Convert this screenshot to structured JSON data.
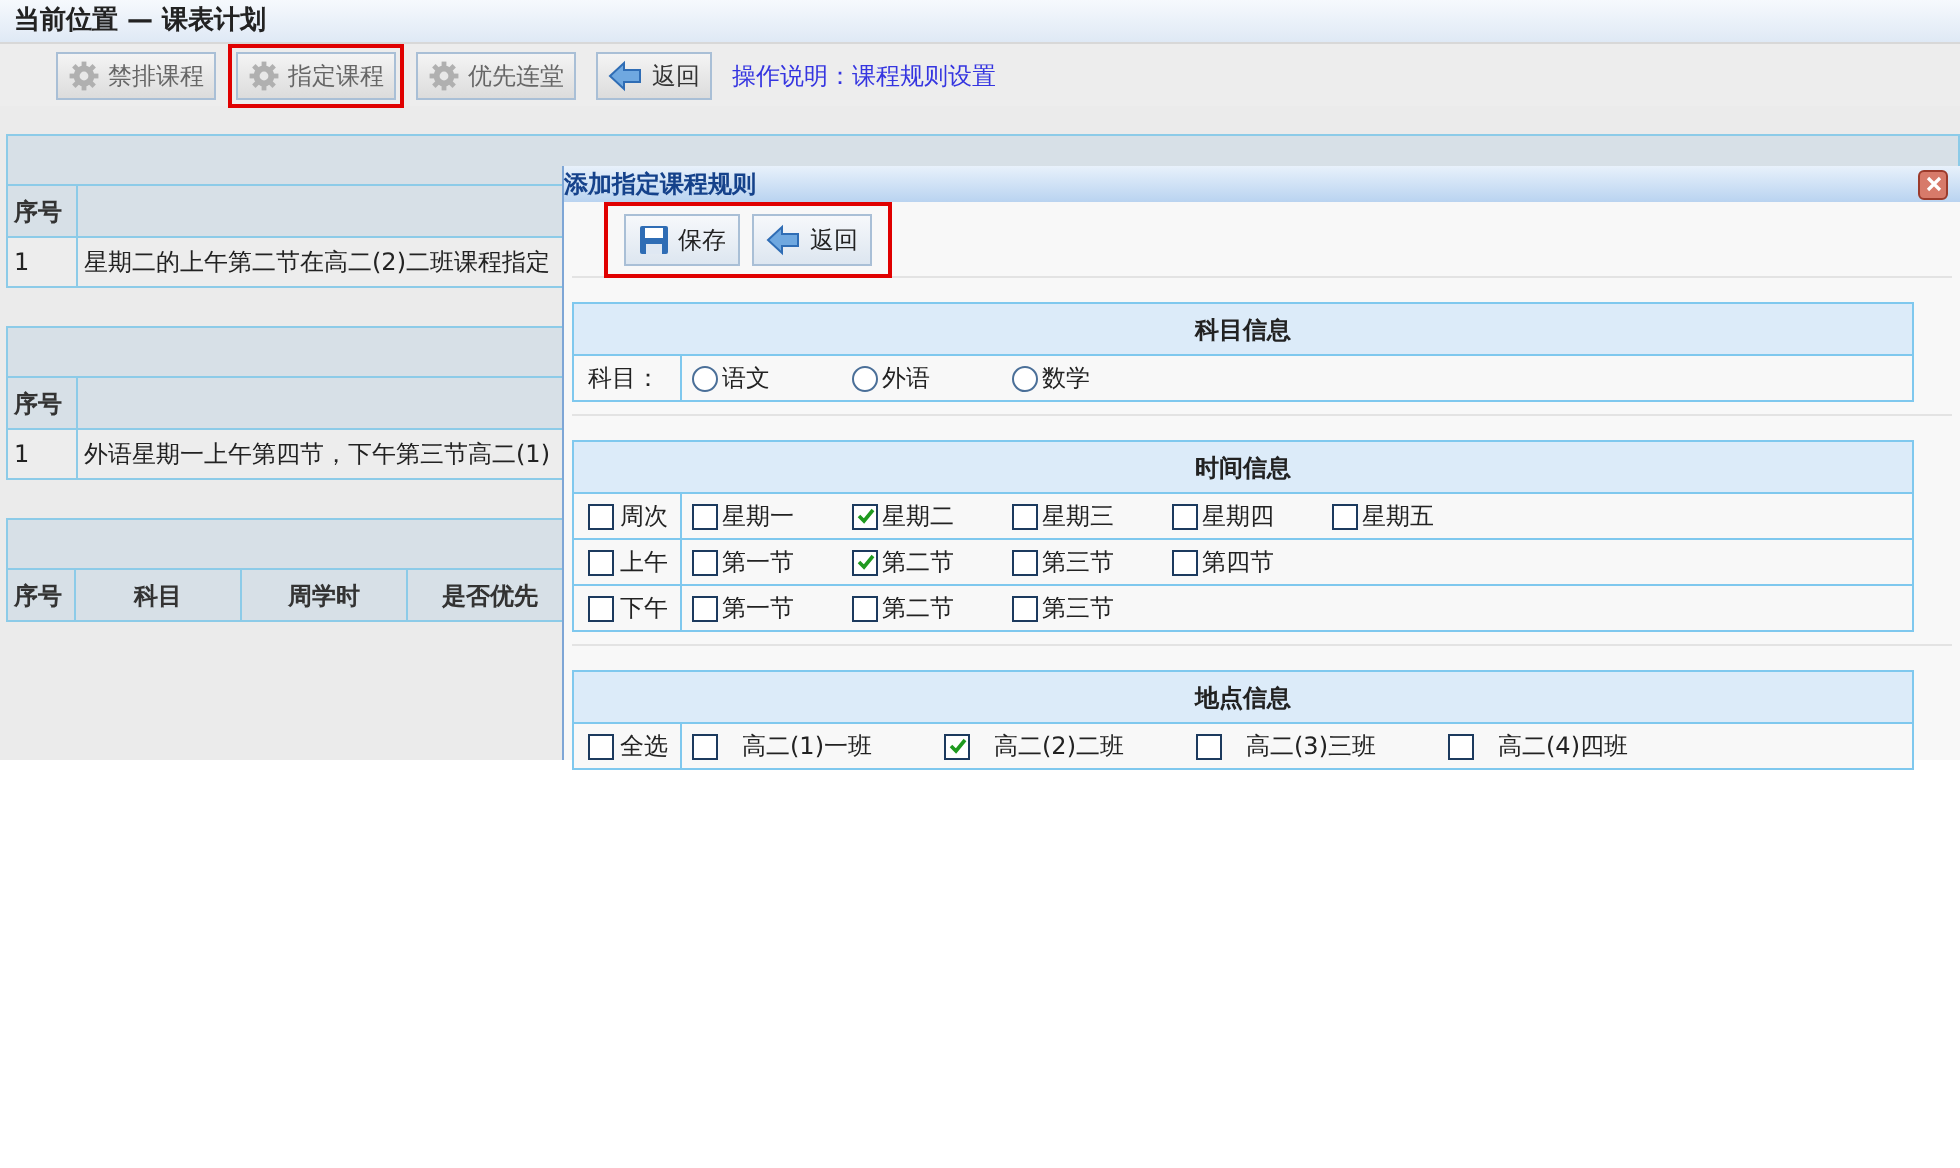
{
  "page_title": "当前位置 — 课表计划",
  "toolbar": {
    "buttons": [
      {
        "label": "禁排课程",
        "kind": "gear",
        "highlighted": false
      },
      {
        "label": "指定课程",
        "kind": "gear",
        "highlighted": true
      },
      {
        "label": "优先连堂",
        "kind": "gear",
        "highlighted": false
      },
      {
        "label": "返回",
        "kind": "back",
        "highlighted": false
      }
    ],
    "help_link": "操作说明：课程规则设置"
  },
  "panels": [
    {
      "columns": [
        "序号"
      ],
      "rows": [
        [
          "1",
          "星期二的上午第二节在高二(2)二班课程指定"
        ]
      ]
    },
    {
      "columns": [
        "序号"
      ],
      "rows": [
        [
          "1",
          "外语星期一上午第四节，下午第三节高二(1)"
        ]
      ]
    },
    {
      "columns": [
        "序号",
        "科目",
        "周学时",
        "是否优先"
      ]
    }
  ],
  "dialog": {
    "title": "添加指定课程规则",
    "buttons_highlighted": true,
    "buttons": [
      {
        "label": "保存",
        "kind": "save"
      },
      {
        "label": "返回",
        "kind": "back"
      }
    ],
    "sections": [
      {
        "title": "科目信息",
        "rows": [
          {
            "kind": "radio",
            "label": "科目：",
            "options": [
              {
                "label": "语文",
                "selected": false
              },
              {
                "label": "外语",
                "selected": false
              },
              {
                "label": "数学",
                "selected": false
              }
            ]
          }
        ]
      },
      {
        "title": "时间信息",
        "rows": [
          {
            "kind": "checkbox",
            "label": "周次",
            "checked": false,
            "options": [
              {
                "label": "星期一",
                "checked": false
              },
              {
                "label": "星期二",
                "checked": true
              },
              {
                "label": "星期三",
                "checked": false
              },
              {
                "label": "星期四",
                "checked": false
              },
              {
                "label": "星期五",
                "checked": false
              }
            ]
          },
          {
            "kind": "checkbox",
            "label": "上午",
            "checked": false,
            "options": [
              {
                "label": "第一节",
                "checked": false
              },
              {
                "label": "第二节",
                "checked": true
              },
              {
                "label": "第三节",
                "checked": false
              },
              {
                "label": "第四节",
                "checked": false
              }
            ]
          },
          {
            "kind": "checkbox",
            "label": "下午",
            "checked": false,
            "options": [
              {
                "label": "第一节",
                "checked": false
              },
              {
                "label": "第二节",
                "checked": false
              },
              {
                "label": "第三节",
                "checked": false
              }
            ]
          }
        ]
      },
      {
        "title": "地点信息",
        "rows": [
          {
            "kind": "classes",
            "label": "全选",
            "checked": false,
            "options": [
              {
                "label": "高二(1)一班",
                "checked": false
              },
              {
                "label": "高二(2)二班",
                "checked": true
              },
              {
                "label": "高二(3)三班",
                "checked": false
              },
              {
                "label": "高二(4)四班",
                "checked": false
              }
            ]
          }
        ]
      }
    ]
  }
}
